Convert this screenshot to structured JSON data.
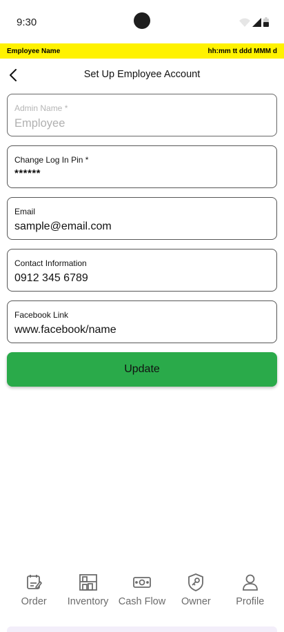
{
  "status_bar": {
    "time": "9:30"
  },
  "info_bar": {
    "employee_name": "Employee Name",
    "datetime": "hh:mm tt ddd MMM d"
  },
  "header": {
    "title": "Set Up Employee Account"
  },
  "form": {
    "admin_name": {
      "label": "Admin Name *",
      "value": "Employee"
    },
    "pin": {
      "label": "Change Log In Pin *",
      "value": "******"
    },
    "email": {
      "label": "Email",
      "value": "sample@email.com"
    },
    "contact": {
      "label": "Contact Information",
      "value": "0912 345 6789"
    },
    "facebook": {
      "label": "Facebook Link",
      "value": "www.facebook/name"
    }
  },
  "update_button": {
    "label": "Update"
  },
  "bottom_nav": {
    "items": [
      {
        "label": "Order",
        "icon": "order-icon"
      },
      {
        "label": "Inventory",
        "icon": "inventory-icon"
      },
      {
        "label": "Cash Flow",
        "icon": "cash-flow-icon"
      },
      {
        "label": "Owner",
        "icon": "owner-icon"
      },
      {
        "label": "Profile",
        "icon": "profile-icon"
      }
    ]
  },
  "colors": {
    "info_bar": "#fff200",
    "primary_button": "#2aaa4a",
    "nav_text": "#6b6b6b"
  }
}
